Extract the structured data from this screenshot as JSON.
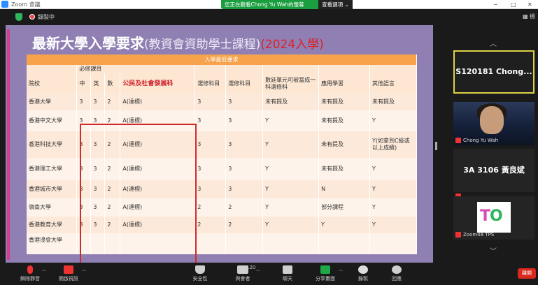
{
  "window": {
    "title": "Zoom 會議",
    "share_banner": "您正在觀看Chong Yu Wah的螢幕",
    "view_options": "查看選項 ⌄",
    "minimize": "─",
    "maximize": "□",
    "close": "✕"
  },
  "meeting": {
    "recording": "錄製中",
    "view_button": "▦ 檢"
  },
  "slide": {
    "title_main": "最新大學入學要求",
    "title_sub": "(教資會資助學士課程)",
    "title_year": "(2024入學)",
    "table_caption": "入學最低要求",
    "col_required": "必修課目",
    "columns": {
      "school": "院校",
      "chi": "中",
      "eng": "英",
      "math": "數",
      "social": "公民及社會發展科",
      "elective1": "選修科目",
      "elective2": "選修科目",
      "m_module": "數延單元可被當成一科選修科",
      "applied": "應用學習",
      "other_lang": "其他語言"
    },
    "rows": [
      {
        "school": "香港大學",
        "chi": "3",
        "eng": "3",
        "math": "2",
        "social": "A(達標)",
        "e1": "3",
        "e2": "3",
        "m": "未有提及",
        "applied": "未有提及",
        "other": "未有提及"
      },
      {
        "school": "香港中文大學",
        "chi": "3",
        "eng": "3",
        "math": "2",
        "social": "A(達標)",
        "e1": "3",
        "e2": "3",
        "m": "Y",
        "applied": "未有提及",
        "other": "Y"
      },
      {
        "school": "香港科技大學",
        "chi": "3",
        "eng": "3",
        "math": "2",
        "social": "A(達標)",
        "e1": "3",
        "e2": "3",
        "m": "Y",
        "applied": "未有提及",
        "other": "Y(如拿到C級或以上成績)"
      },
      {
        "school": "香港理工大學",
        "chi": "3",
        "eng": "3",
        "math": "2",
        "social": "A(達標)",
        "e1": "3",
        "e2": "3",
        "m": "Y",
        "applied": "未有提及",
        "other": "Y"
      },
      {
        "school": "香港城市大學",
        "chi": "3",
        "eng": "3",
        "math": "2",
        "social": "A(達標)",
        "e1": "3",
        "e2": "3",
        "m": "Y",
        "applied": "N",
        "other": "Y"
      },
      {
        "school": "嶺南大學",
        "chi": "3",
        "eng": "3",
        "math": "2",
        "social": "A(達標)",
        "e1": "2",
        "e2": "2",
        "m": "Y",
        "applied": "部分課程",
        "other": "Y"
      },
      {
        "school": "香港教育大學",
        "chi": "3",
        "eng": "3",
        "math": "2",
        "social": "A(達標)",
        "e1": "2",
        "e2": "2",
        "m": "Y",
        "applied": "Y",
        "other": "Y"
      }
    ],
    "last_school": "香港浸會大學"
  },
  "participants": [
    {
      "name": "S120181  Chong...",
      "label": ""
    },
    {
      "name": "",
      "label": "Chong Yu Wah"
    },
    {
      "name": "3A  3106 黃良斌",
      "label": ""
    },
    {
      "name": "",
      "label": "Zoom48 TPS"
    }
  ],
  "logo_text": {
    "t": "T",
    "o": "O"
  },
  "nav": {
    "up": "︿",
    "down": "﹀"
  },
  "toolbar": {
    "mute": "解除靜音",
    "video": "開啟視訊",
    "security": "安全性",
    "participants": "與會者",
    "participants_count": "120",
    "chat": "聊天",
    "share": "分享畫面",
    "record": "錄製",
    "reactions": "回應",
    "end": "離開"
  },
  "colors": {
    "slide_bg": "#8f7fb2",
    "header_bar": "#f6a34b",
    "highlight_red": "#d12a2a",
    "highlight_green": "#5bbf5b",
    "share_banner": "#1a9e3f",
    "end_button": "#d9281d"
  }
}
